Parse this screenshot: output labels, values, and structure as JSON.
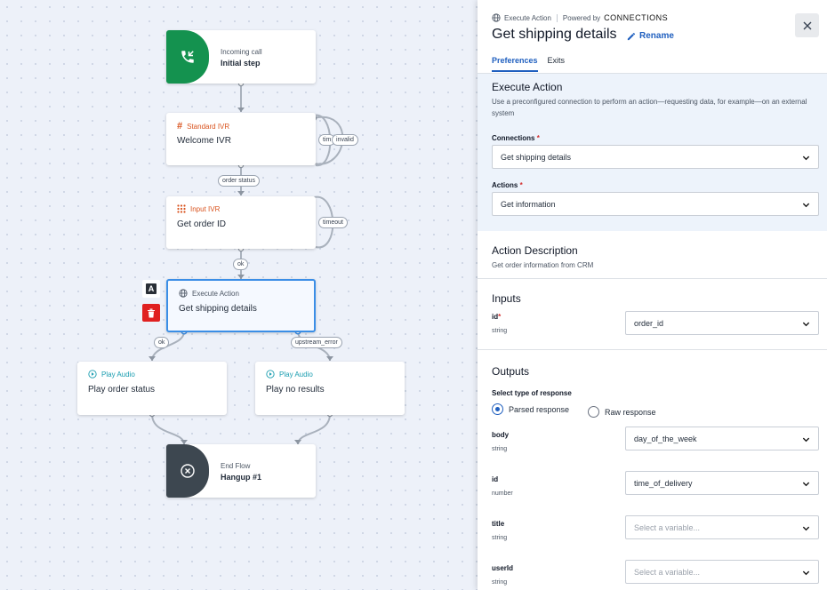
{
  "canvas": {
    "nodes": {
      "incoming": {
        "type_label": "Incoming call",
        "title": "Initial step",
        "color": "#14924f"
      },
      "welcome": {
        "type_label": "Standard IVR",
        "title": "Welcome IVR"
      },
      "input": {
        "type_label": "Input IVR",
        "title": "Get order ID"
      },
      "execute": {
        "type_label": "Execute Action",
        "title": "Get shipping details"
      },
      "play1": {
        "type_label": "Play Audio",
        "title": "Play order status"
      },
      "play2": {
        "type_label": "Play Audio",
        "title": "Play no results"
      },
      "end": {
        "type_label": "End Flow",
        "title": "Hangup #1",
        "color": "#3d4750"
      }
    },
    "edge_labels": {
      "welcome_tim": "tim",
      "welcome_invalid": "invalid",
      "order_status": "order status",
      "input_timeout": "timeout",
      "ok1": "ok",
      "ok2": "ok",
      "upstream_error": "upstream_error"
    },
    "side_buttons": {
      "rename_badge": "A",
      "delete_color": "#e02020"
    }
  },
  "panel": {
    "breadcrumb": {
      "type": "Execute Action",
      "powered_by": "Powered by",
      "brand": "CONNECTIONS"
    },
    "title": "Get shipping details",
    "rename_label": "Rename",
    "tabs": [
      {
        "label": "Preferences",
        "active": true
      },
      {
        "label": "Exits",
        "active": false
      }
    ],
    "execute": {
      "heading": "Execute Action",
      "description": "Use a preconfigured connection to perform an action—requesting data, for example—on an external system",
      "connections_label": "Connections",
      "connections_value": "Get shipping details",
      "actions_label": "Actions",
      "actions_value": "Get information"
    },
    "action_description": {
      "heading": "Action Description",
      "text": "Get order information from CRM"
    },
    "inputs": {
      "heading": "Inputs",
      "rows": [
        {
          "name": "id",
          "type": "string",
          "value": "order_id",
          "required": "*"
        }
      ]
    },
    "outputs": {
      "heading": "Outputs",
      "response_label": "Select type of response",
      "response_options": [
        {
          "label": "Parsed response",
          "selected": true
        },
        {
          "label": "Raw response",
          "selected": false
        }
      ],
      "rows": [
        {
          "name": "body",
          "type": "string",
          "value": "day_of_the_week"
        },
        {
          "name": "id",
          "type": "number",
          "value": "time_of_delivery"
        },
        {
          "name": "title",
          "type": "string",
          "value": "Select a variable..."
        },
        {
          "name": "userId",
          "type": "string",
          "value": "Select a variable..."
        }
      ]
    },
    "accent_color": "#1f5fbf"
  }
}
